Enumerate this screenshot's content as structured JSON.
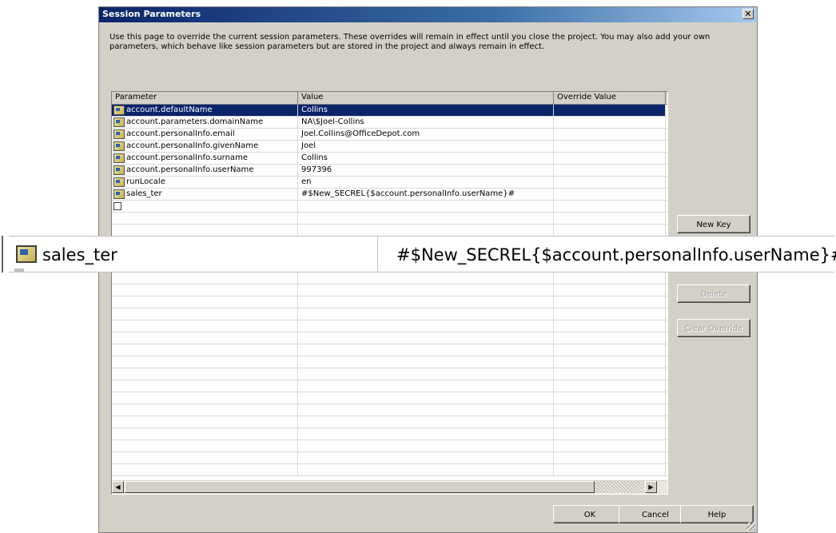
{
  "dialog": {
    "title": "Session Parameters",
    "close_glyph": "✕",
    "description": "Use this page to override the current session parameters. These overrides will remain in effect until you close the project. You may also add your own parameters, which behave like session parameters but are stored in the project and always remain in effect."
  },
  "grid": {
    "columns": [
      "Parameter",
      "Value",
      "Override Value"
    ],
    "rows": [
      {
        "parameter": "account.defaultName",
        "value": "Collins",
        "override": "",
        "selected": true
      },
      {
        "parameter": "account.parameters.domainName",
        "value": "NA\\$Joel-Collins",
        "override": ""
      },
      {
        "parameter": "account.personalInfo.email",
        "value": "Joel.Collins@OfficeDepot.com",
        "override": ""
      },
      {
        "parameter": "account.personalInfo.givenName",
        "value": "Joel",
        "override": ""
      },
      {
        "parameter": "account.personalInfo.surname",
        "value": "Collins",
        "override": ""
      },
      {
        "parameter": "account.personalInfo.userName",
        "value": "997396",
        "override": ""
      },
      {
        "parameter": "runLocale",
        "value": "en",
        "override": ""
      },
      {
        "parameter": "sales_ter",
        "value": "#$New_SECREL{$account.personalInfo.userName}#",
        "override": ""
      }
    ]
  },
  "buttons": {
    "new_key": "New Key",
    "delete": "Delete",
    "clear_override": "Clear Override",
    "ok": "OK",
    "cancel": "Cancel",
    "help": "Help"
  },
  "zoom": {
    "name": "sales_ter",
    "value": "#$New_SECREL{$account.personalInfo.userName}#"
  }
}
